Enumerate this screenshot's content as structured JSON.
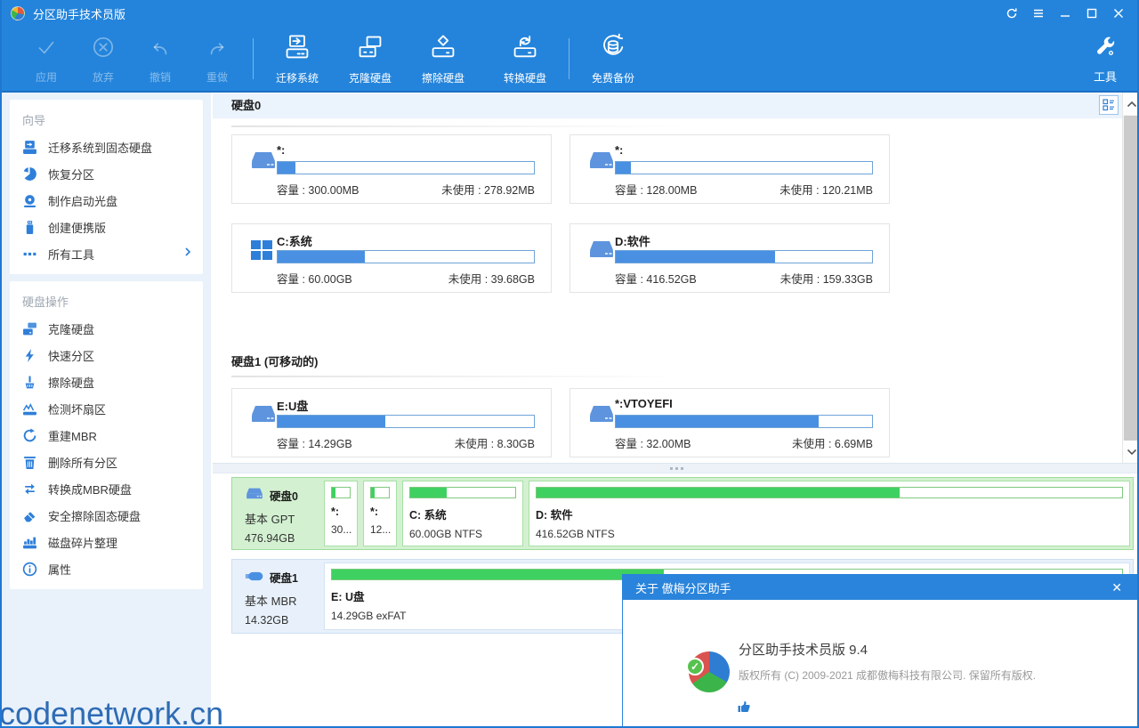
{
  "window": {
    "title": "分区助手技术员版",
    "controls": {
      "refresh": "refresh",
      "menu": "menu",
      "minimize": "minimize",
      "maximize": "maximize",
      "close": "close"
    }
  },
  "toolbar": {
    "actions": [
      {
        "label": "应用",
        "icon": "check-icon",
        "disabled": true
      },
      {
        "label": "放弃",
        "icon": "cancel-circle-icon",
        "disabled": true
      },
      {
        "label": "撤销",
        "icon": "undo-icon",
        "disabled": true
      },
      {
        "label": "重做",
        "icon": "redo-icon",
        "disabled": true
      },
      {
        "label": "迁移系统",
        "icon": "migrate-disk-icon",
        "disabled": false
      },
      {
        "label": "克隆硬盘",
        "icon": "clone-disk-icon",
        "disabled": false
      },
      {
        "label": "擦除硬盘",
        "icon": "wipe-disk-icon",
        "disabled": false
      },
      {
        "label": "转换硬盘",
        "icon": "convert-disk-icon",
        "disabled": false
      },
      {
        "label": "免费备份",
        "icon": "backup-icon",
        "disabled": false
      }
    ],
    "tools_label": "工具",
    "tools_icon": "wrench-icon"
  },
  "sidebar": {
    "wizard": {
      "title": "向导",
      "items": [
        {
          "label": "迁移系统到固态硬盘",
          "icon": "migrate-ssd-icon"
        },
        {
          "label": "恢复分区",
          "icon": "recover-partition-icon"
        },
        {
          "label": "制作启动光盘",
          "icon": "boot-disc-icon"
        },
        {
          "label": "创建便携版",
          "icon": "portable-usb-icon"
        },
        {
          "label": "所有工具",
          "icon": "all-tools-icon",
          "chevron": true
        }
      ]
    },
    "disk_ops": {
      "title": "硬盘操作",
      "items": [
        {
          "label": "克隆硬盘",
          "icon": "clone-disk-icon"
        },
        {
          "label": "快速分区",
          "icon": "quick-partition-icon"
        },
        {
          "label": "擦除硬盘",
          "icon": "wipe-disk-icon"
        },
        {
          "label": "检测坏扇区",
          "icon": "bad-sector-icon"
        },
        {
          "label": "重建MBR",
          "icon": "rebuild-mbr-icon"
        },
        {
          "label": "删除所有分区",
          "icon": "delete-partitions-icon"
        },
        {
          "label": "转换成MBR硬盘",
          "icon": "convert-mbr-icon"
        },
        {
          "label": "安全擦除固态硬盘",
          "icon": "secure-erase-icon"
        },
        {
          "label": "磁盘碎片整理",
          "icon": "defrag-icon"
        },
        {
          "label": "属性",
          "icon": "properties-icon"
        }
      ]
    }
  },
  "overview": {
    "disk0": {
      "header": "硬盘0",
      "cards": [
        {
          "title": "*:",
          "capacity": "容量 : 300.00MB",
          "unused": "未使用 : 278.92MB",
          "used_pct": 7,
          "icon": "drive-icon"
        },
        {
          "title": "*:",
          "capacity": "容量 : 128.00MB",
          "unused": "未使用 : 120.21MB",
          "used_pct": 6,
          "icon": "drive-icon"
        },
        {
          "title": "C:系统",
          "capacity": "容量 : 60.00GB",
          "unused": "未使用 : 39.68GB",
          "used_pct": 34,
          "icon": "windows-icon"
        },
        {
          "title": "D:软件",
          "capacity": "容量 : 416.52GB",
          "unused": "未使用 : 159.33GB",
          "used_pct": 62,
          "icon": "drive-icon"
        }
      ]
    },
    "disk1": {
      "header": "硬盘1 (可移动的)",
      "cards": [
        {
          "title": "E:U盘",
          "capacity": "容量 : 14.29GB",
          "unused": "未使用 : 8.30GB",
          "used_pct": 42,
          "icon": "drive-icon"
        },
        {
          "title": "*:VTOYEFI",
          "capacity": "容量 : 32.00MB",
          "unused": "未使用 : 6.69MB",
          "used_pct": 79,
          "icon": "drive-icon"
        }
      ]
    }
  },
  "disk_map": {
    "rows": [
      {
        "name": "硬盘0",
        "meta": "基本 GPT",
        "size": "476.94GB",
        "selected": true,
        "icon": "hdd-icon",
        "partitions": [
          {
            "label": "*:",
            "info": "30...",
            "used_pct": 22
          },
          {
            "label": "*:",
            "info": "12...",
            "used_pct": 22
          },
          {
            "label": "C: 系统",
            "info": "60.00GB NTFS",
            "used_pct": 35
          },
          {
            "label": "D: 软件",
            "info": "416.52GB NTFS",
            "used_pct": 62
          }
        ]
      },
      {
        "name": "硬盘1",
        "meta": "基本 MBR",
        "size": "14.32GB",
        "selected": false,
        "icon": "usb-icon",
        "partitions": [
          {
            "label": "E: U盘",
            "info": "14.29GB exFAT",
            "used_pct": 42
          }
        ]
      }
    ]
  },
  "about_dialog": {
    "title": "关于 傲梅分区助手",
    "close_icon": "✕",
    "product": "分区助手技术员版 9.4",
    "copyright": "版权所有 (C) 2009-2021 成都傲梅科技有限公司. 保留所有版权.",
    "logo_icon": "pie-logo-icon",
    "thumb_icon": "thumbs-up-icon"
  },
  "watermark": "codenetwork.cn",
  "colors": {
    "accent_blue": "#2484db",
    "bar_blue": "#4a90e2",
    "used_green": "#3ed161",
    "selected_row_green": "#d3f1d1",
    "dialog_blue": "#2a84db"
  }
}
